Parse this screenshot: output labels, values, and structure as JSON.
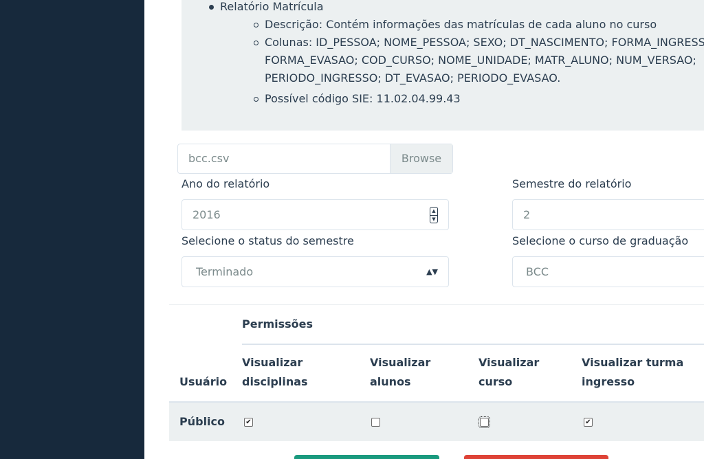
{
  "report": {
    "title": "Relatório Matrícula",
    "description": "Descrição: Contém informações das matrículas de cada aluno no curso",
    "columns_line1": "Colunas: ID_PESSOA; NOME_PESSOA; SEXO; DT_NASCIMENTO; FORMA_INGRESSO;",
    "columns_line2": "FORMA_EVASAO; COD_CURSO; NOME_UNIDADE; MATR_ALUNO; NUM_VERSAO;",
    "columns_line3": "PERIODO_INGRESSO; DT_EVASAO; PERIODO_EVASAO.",
    "sie_code": "Possível código SIE: 11.02.04.99.43"
  },
  "upload": {
    "file_name": "bcc.csv",
    "browse_label": "Browse"
  },
  "form": {
    "year_label": "Ano do relatório",
    "year_value": "2016",
    "semester_label": "Semestre do relatório",
    "semester_value": "2",
    "status_label": "Selecione o status do semestre",
    "status_value": "Terminado",
    "course_label": "Selecione o curso de graduação",
    "course_value": "BCC"
  },
  "permissions": {
    "group_header": "Permissões",
    "user_header": "Usuário",
    "columns": [
      {
        "line1": "Visualizar",
        "line2": "disciplinas"
      },
      {
        "line1": "Visualizar",
        "line2": "alunos"
      },
      {
        "line1": "Visualizar",
        "line2": "curso"
      },
      {
        "line1": "Visualizar turma",
        "line2": "ingresso"
      }
    ],
    "row": {
      "user": "Público",
      "values": [
        true,
        false,
        false,
        true
      ]
    }
  },
  "colors": {
    "sidebar": "#17293c",
    "panel": "#ecf0f1",
    "primary_button": "#1a9a7e",
    "danger_button": "#de4337"
  }
}
